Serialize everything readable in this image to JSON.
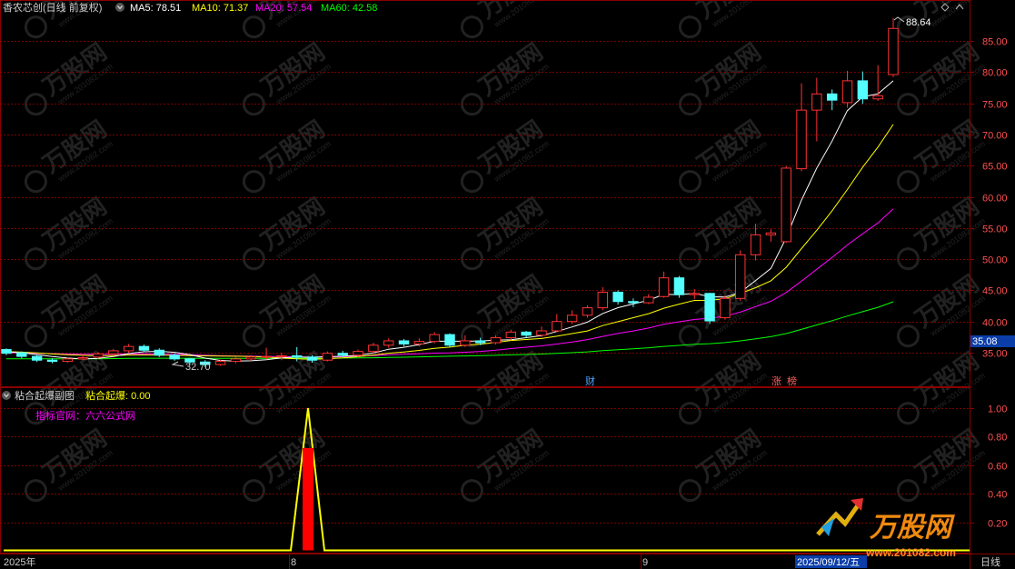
{
  "main_header": {
    "stock_title": "香农芯创(日线 前复权)",
    "ma": [
      {
        "label": "MA5: 78.51",
        "color": "#ffffff"
      },
      {
        "label": "MA10: 71.37",
        "color": "#ffff00"
      },
      {
        "label": "MA20: 57.54",
        "color": "#ff00ff"
      },
      {
        "label": "MA60: 42.58",
        "color": "#00ff00"
      }
    ]
  },
  "price_axis": {
    "ticks": [
      "85.00",
      "80.00",
      "75.00",
      "70.00",
      "65.00",
      "60.00",
      "55.00",
      "50.00",
      "45.00",
      "40.00",
      "35.00"
    ],
    "current_price": "35.08"
  },
  "annotations": {
    "high_label": "88.64",
    "low_label": "32.70",
    "markers": [
      {
        "text": "财",
        "color": "#4fa3ff"
      },
      {
        "text": "涨",
        "color": "#ff6060"
      },
      {
        "text": "榜",
        "color": "#ff6060"
      }
    ]
  },
  "sub_header": {
    "indicator_name": "粘合起爆副图",
    "value_label": "粘合起爆: 0.00",
    "site_label": "指标官网：六六公式网"
  },
  "sub_axis": {
    "ticks": [
      "1.00",
      "0.80",
      "0.60",
      "0.40",
      "0.20"
    ]
  },
  "date_axis": {
    "labels": [
      "2025年",
      "8",
      "9"
    ],
    "cursor_date": "2025/09/12/五",
    "period": "日线"
  },
  "watermark": {
    "brand": "万股网",
    "url": "www.201082.com"
  },
  "colors": {
    "up": "#ff3232",
    "down": "#54ffff",
    "grid": "#7a0000",
    "axis_text": "#ff5050",
    "signal_line": "#ffff00",
    "signal_bar": "#ff0000"
  },
  "chart_data": {
    "type": "candlestick",
    "ylim": [
      31.5,
      89.5
    ],
    "candles": [
      [
        35.5,
        34.9,
        35.7,
        34.6
      ],
      [
        35.0,
        34.4,
        35.2,
        34.1
      ],
      [
        34.4,
        33.8,
        34.7,
        33.5
      ],
      [
        33.8,
        33.6,
        34.1,
        33.3
      ],
      [
        33.6,
        34.0,
        34.3,
        33.4
      ],
      [
        34.0,
        34.2,
        34.6,
        33.8
      ],
      [
        34.3,
        34.8,
        35.1,
        34.0
      ],
      [
        34.8,
        35.3,
        35.6,
        34.5
      ],
      [
        35.3,
        36.0,
        36.4,
        35.0
      ],
      [
        36.0,
        35.4,
        36.3,
        35.1
      ],
      [
        35.4,
        34.6,
        35.7,
        34.3
      ],
      [
        34.6,
        34.0,
        34.9,
        33.7
      ],
      [
        34.0,
        33.5,
        34.2,
        33.1
      ],
      [
        33.5,
        33.1,
        33.8,
        32.7
      ],
      [
        33.1,
        33.6,
        33.9,
        32.9
      ],
      [
        33.6,
        34.0,
        34.3,
        33.3
      ],
      [
        34.0,
        34.3,
        34.6,
        33.7
      ],
      [
        34.3,
        34.4,
        35.8,
        33.9
      ],
      [
        34.4,
        34.5,
        35.0,
        33.8
      ],
      [
        34.5,
        34.3,
        35.9,
        33.6
      ],
      [
        34.3,
        33.8,
        34.6,
        33.4
      ],
      [
        33.8,
        34.9,
        35.2,
        33.6
      ],
      [
        34.9,
        34.6,
        35.3,
        34.3
      ],
      [
        34.6,
        35.2,
        35.5,
        34.3
      ],
      [
        35.2,
        36.2,
        36.6,
        34.9
      ],
      [
        36.2,
        36.9,
        37.3,
        35.8
      ],
      [
        36.9,
        36.4,
        37.2,
        36.0
      ],
      [
        36.4,
        36.8,
        37.3,
        36.0
      ],
      [
        36.8,
        37.9,
        38.3,
        36.5
      ],
      [
        37.9,
        36.2,
        38.1,
        35.8
      ],
      [
        36.2,
        36.9,
        37.8,
        35.9
      ],
      [
        36.9,
        36.6,
        37.4,
        36.2
      ],
      [
        36.6,
        37.4,
        37.8,
        36.3
      ],
      [
        37.4,
        38.3,
        38.7,
        37.0
      ],
      [
        38.3,
        37.8,
        38.5,
        37.4
      ],
      [
        37.8,
        38.5,
        39.2,
        37.5
      ],
      [
        38.5,
        40.0,
        41.2,
        38.3
      ],
      [
        40.0,
        41.0,
        41.8,
        39.6
      ],
      [
        41.0,
        42.2,
        42.6,
        40.6
      ],
      [
        42.2,
        44.7,
        45.5,
        41.8
      ],
      [
        44.7,
        43.2,
        45.0,
        42.7
      ],
      [
        43.2,
        43.0,
        43.7,
        42.3
      ],
      [
        43.0,
        43.9,
        44.4,
        42.8
      ],
      [
        44.0,
        47.0,
        48.0,
        43.8
      ],
      [
        47.0,
        44.3,
        47.3,
        43.8
      ],
      [
        44.3,
        44.5,
        45.2,
        43.6
      ],
      [
        44.5,
        40.1,
        44.6,
        39.6
      ],
      [
        40.6,
        43.7,
        44.2,
        40.3
      ],
      [
        43.7,
        50.7,
        51.4,
        43.3
      ],
      [
        50.7,
        53.9,
        55.7,
        49.8
      ],
      [
        53.9,
        54.2,
        54.8,
        52.8
      ],
      [
        52.8,
        64.6,
        64.9,
        52.6
      ],
      [
        64.5,
        73.9,
        78.2,
        64.1
      ],
      [
        73.9,
        76.5,
        79.1,
        68.9
      ],
      [
        76.5,
        75.5,
        77.2,
        73.9
      ],
      [
        75.1,
        78.6,
        80.2,
        74.3
      ],
      [
        78.6,
        75.7,
        80.1,
        74.9
      ],
      [
        75.7,
        76.2,
        81.1,
        75.4
      ],
      [
        79.6,
        87.0,
        88.64,
        79.2
      ]
    ],
    "ma_values": {
      "MA5": 78.51,
      "MA10": 71.37,
      "MA20": 57.54,
      "MA60": 42.58
    },
    "signal": {
      "ylim": [
        0,
        1
      ],
      "spike_value": 1.0,
      "bar_value": 0.72,
      "value": 0.0
    }
  }
}
